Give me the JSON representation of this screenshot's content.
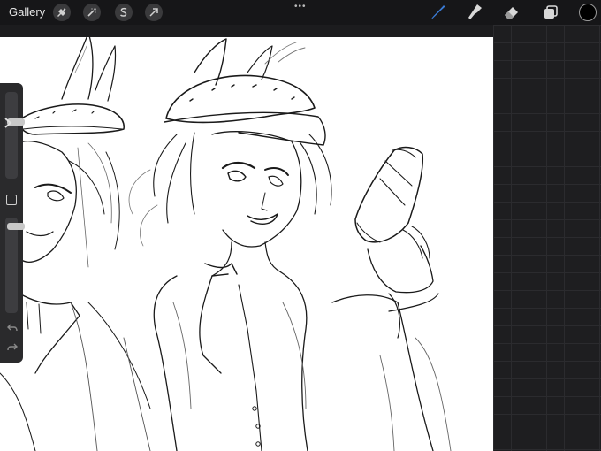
{
  "toolbar": {
    "gallery_label": "Gallery",
    "left_tools": [
      "wrench-icon",
      "magic-wand-icon",
      "selection-s-icon",
      "transform-arrow-icon"
    ],
    "more_indicator": "•••",
    "right_tools": [
      "brush-icon",
      "smudge-icon",
      "eraser-icon",
      "layers-icon"
    ],
    "active_tool": "brush",
    "current_color": "#000000",
    "accent_color": "#3a7bd5"
  },
  "sidebar": {
    "brush_size_level": 0.1,
    "opacity_level": 0.05,
    "icons": [
      "chevron-right-icon",
      "modify-square-icon",
      "undo-icon",
      "redo-icon"
    ]
  },
  "canvas": {
    "background": "#ffffff",
    "content": "pencil-sketch"
  }
}
